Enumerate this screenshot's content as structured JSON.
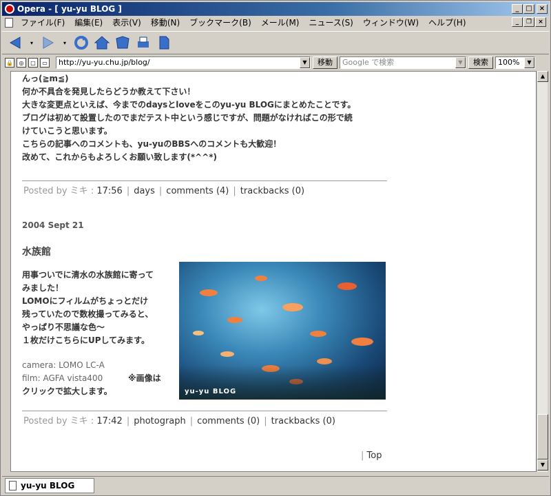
{
  "window": {
    "title": "Opera - [ yu-yu BLOG ]"
  },
  "menu": {
    "items": [
      "ファイル(F)",
      "編集(E)",
      "表示(V)",
      "移動(N)",
      "ブックマーク(B)",
      "メール(M)",
      "ニュース(S)",
      "ウィンドウ(W)",
      "ヘルプ(H)"
    ]
  },
  "address": {
    "url": "http://yu-yu.chu.jp/blog/",
    "go_label": "移動",
    "search_placeholder": "Google で検索",
    "search_button": "検索",
    "zoom": "100%"
  },
  "entry1": {
    "lines": [
      "んっ(≧m≦)",
      "何か不具合を発見したらどうか教えて下さい！",
      "大きな変更点といえば、今までのdaysとloveをこのyu-yu BLOGにまとめたことです。",
      "ブログは初めて設置したのでまだテスト中という感じですが、問題がなければこの形で続",
      "けていこうと思います。",
      "こちらの記事へのコメントも、yu-yuのBBSへのコメントも大歓迎！",
      "改めて、これからもよろしくお願い致します(*^^*)"
    ],
    "posted_by": "Posted by",
    "author": "ミキ",
    "time": "17:56",
    "category": "days",
    "comments": "comments (4)",
    "trackbacks": "trackbacks (0)"
  },
  "entry2": {
    "date": "2004 Sept 21",
    "title": "水族館",
    "lines": [
      "用事ついでに清水の水族館に寄って",
      "みました！",
      "LOMOにフィルムがちょっとだけ",
      "残っていたので数枚撮ってみると、",
      "やっぱり不思議な色～",
      "１枚だけこちらにUPしてみます。"
    ],
    "camera": "camera: LOMO LC-A",
    "film": "film: AGFA vista400",
    "note": "※画像は",
    "note2": "クリックで拡大します。",
    "watermark": "yu-yu BLOG",
    "posted_by": "Posted by",
    "author": "ミキ",
    "time": "17:42",
    "category": "photograph",
    "comments": "comments (0)",
    "trackbacks": "trackbacks (0)"
  },
  "footer": {
    "top_link": "Top",
    "sep": "|"
  },
  "tab": {
    "label": "yu-yu BLOG"
  }
}
